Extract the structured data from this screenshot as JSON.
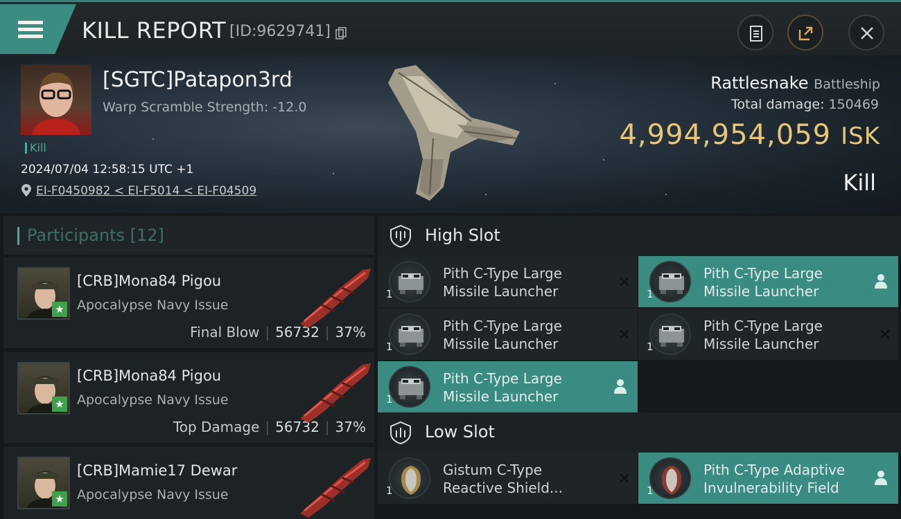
{
  "header": {
    "title": "KILL REPORT",
    "report_id": "[ID:9629741]",
    "buttons": [
      "clipboard-icon",
      "export-icon",
      "close-icon"
    ]
  },
  "victim": {
    "pilot": "[SGTC]Patapon3rd",
    "warp_scramble": "Warp Scramble Strength: -12.0",
    "tag": "Kill",
    "datetime": "2024/07/04 12:58:15 UTC +1",
    "location": "EI-F0450982 < EI-F5014 < EI-F04509",
    "ship_name": "Rattlesnake",
    "ship_class": "Battleship",
    "total_damage_label": "Total damage:",
    "total_damage": "150469",
    "isk_value": "4,994,954,059",
    "isk_unit": "ISK",
    "result": "Kill"
  },
  "participants": {
    "title": "Participants",
    "count": "[12]",
    "rows": [
      {
        "name": "[CRB]Mona84 Pigou",
        "ship": "Apocalypse Navy Issue",
        "label": "Final Blow",
        "damage": "56732",
        "percent": "37%"
      },
      {
        "name": "[CRB]Mona84 Pigou",
        "ship": "Apocalypse Navy Issue",
        "label": "Top Damage",
        "damage": "56732",
        "percent": "37%"
      },
      {
        "name": "[CRB]Mamie17 Dewar",
        "ship": "Apocalypse Navy Issue",
        "label": "",
        "damage": "",
        "percent": ""
      }
    ]
  },
  "slots": {
    "high": {
      "title": "High Slot",
      "items": [
        {
          "qty": "1",
          "name": "Pith C-Type Large Missile Launcher",
          "state": "destroyed"
        },
        {
          "qty": "1",
          "name": "Pith C-Type Large Missile Launcher",
          "state": "dropped"
        },
        {
          "qty": "1",
          "name": "Pith C-Type Large Missile Launcher",
          "state": "destroyed"
        },
        {
          "qty": "1",
          "name": "Pith C-Type Large Missile Launcher",
          "state": "destroyed"
        },
        {
          "qty": "1",
          "name": "Pith C-Type Large Missile Launcher",
          "state": "dropped"
        }
      ]
    },
    "low": {
      "title": "Low Slot",
      "items": [
        {
          "qty": "1",
          "name": "Gistum C-Type Reactive Shield...",
          "state": "destroyed"
        },
        {
          "qty": "1",
          "name": "Pith C-Type Adaptive Invulnerability Field",
          "state": "dropped"
        }
      ]
    }
  },
  "colors": {
    "accent": "#3b8d82",
    "isk": "#e7c67a",
    "star_badge": "#3fa04e"
  }
}
